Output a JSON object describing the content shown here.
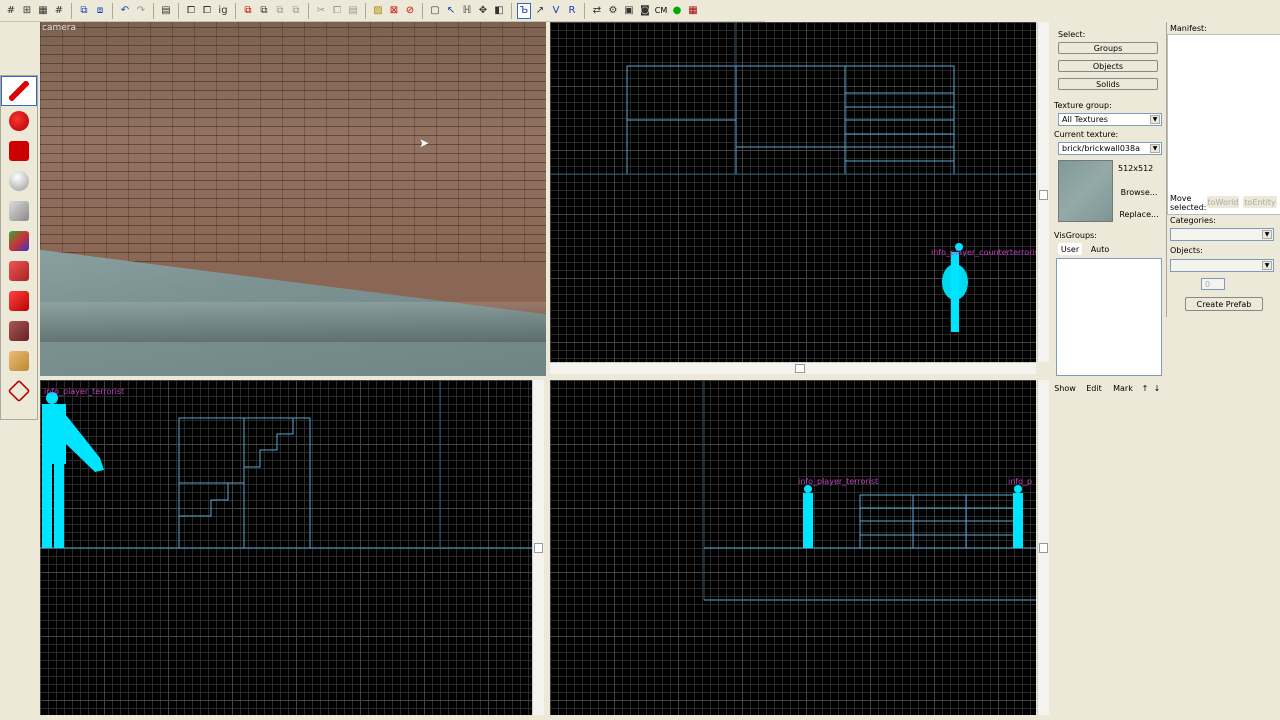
{
  "toolbar": {
    "items": [
      "grid-icon",
      "grid-icon",
      "grid-icon",
      "grid-icon",
      "group-icon",
      "group-icon",
      "undo-icon",
      "redo-icon",
      "paste-icon",
      "copy-icon",
      "copy-icon",
      "ig-icon",
      "cut-icon",
      "copy-icon",
      "paste-icon",
      "hazard-icon",
      "crosshair-icon",
      "no-icon",
      "select-icon",
      "pointer-icon",
      "h-icon",
      "move-icon",
      "rotate-icon",
      "d-icon",
      "rotate-icon",
      "v-icon",
      "r-icon",
      "swap-icon",
      "compile-icon",
      "film-icon",
      "camera-icon",
      "cm-text",
      "green-icon",
      "unread-icon"
    ],
    "cm_label": "CM"
  },
  "palette": {
    "tools": [
      "pencil-tool",
      "entity-tool",
      "block-tool",
      "sphere-tool",
      "cube-tool",
      "texture-tool",
      "overlay-tool",
      "decal-tool",
      "apply-tool",
      "clip-tool",
      "vertex-tool"
    ]
  },
  "viewports": {
    "camera_label": "camera",
    "top_right_entity": "info_player_counterterrorist",
    "bottom_left_entity": "info_player_terrorist",
    "bottom_right_entity_1": "info_player_terrorist",
    "bottom_right_entity_2": "info_p"
  },
  "panel": {
    "select_label": "Select:",
    "groups_button": "Groups",
    "objects_button": "Objects",
    "solids_button": "Solids",
    "texture_group_label": "Texture group:",
    "texture_group_value": "All Textures",
    "current_texture_label": "Current texture:",
    "current_texture_value": "brick/brickwall038a",
    "texture_size": "512x512",
    "browse_button": "Browse...",
    "replace_button": "Replace...",
    "visgroups_label": "VisGroups:",
    "tab_user": "User",
    "tab_auto": "Auto",
    "show_button": "Show",
    "edit_button": "Edit",
    "mark_button": "Mark"
  },
  "manifest": {
    "title": "Manifest:",
    "move_selected_label": "Move selected:",
    "to_world_button": "toWorld",
    "to_entity_button": "toEntity",
    "categories_label": "Categories:",
    "objects_label": "Objects:",
    "count_value": "0",
    "create_prefab_button": "Create Prefab"
  },
  "colors": {
    "wire": "#00e5ff",
    "entity_label": "#c040c0",
    "brush_line": "#6fb0d0"
  }
}
